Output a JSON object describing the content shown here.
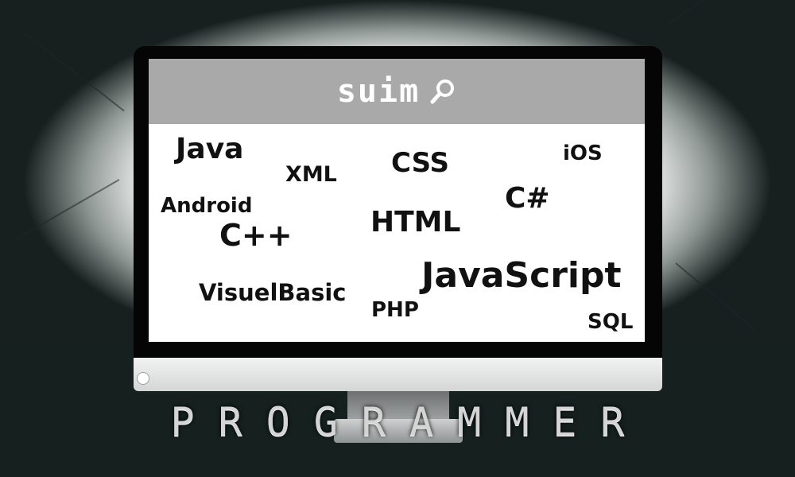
{
  "search": {
    "term": "suim",
    "icon": "search-icon"
  },
  "keywords": [
    "Java",
    "XML",
    "CSS",
    "iOS",
    "C#",
    "Android",
    "C++",
    "HTML",
    "JavaScript",
    "VisuelBasic",
    "PHP",
    "SQL"
  ],
  "footer": {
    "title": "PROGRAMMER"
  },
  "colors": {
    "background": "#17201f",
    "search_bar": "#a9a9a9",
    "screen": "#ffffff",
    "bezel": "#050505",
    "keyword_text": "#111111"
  }
}
